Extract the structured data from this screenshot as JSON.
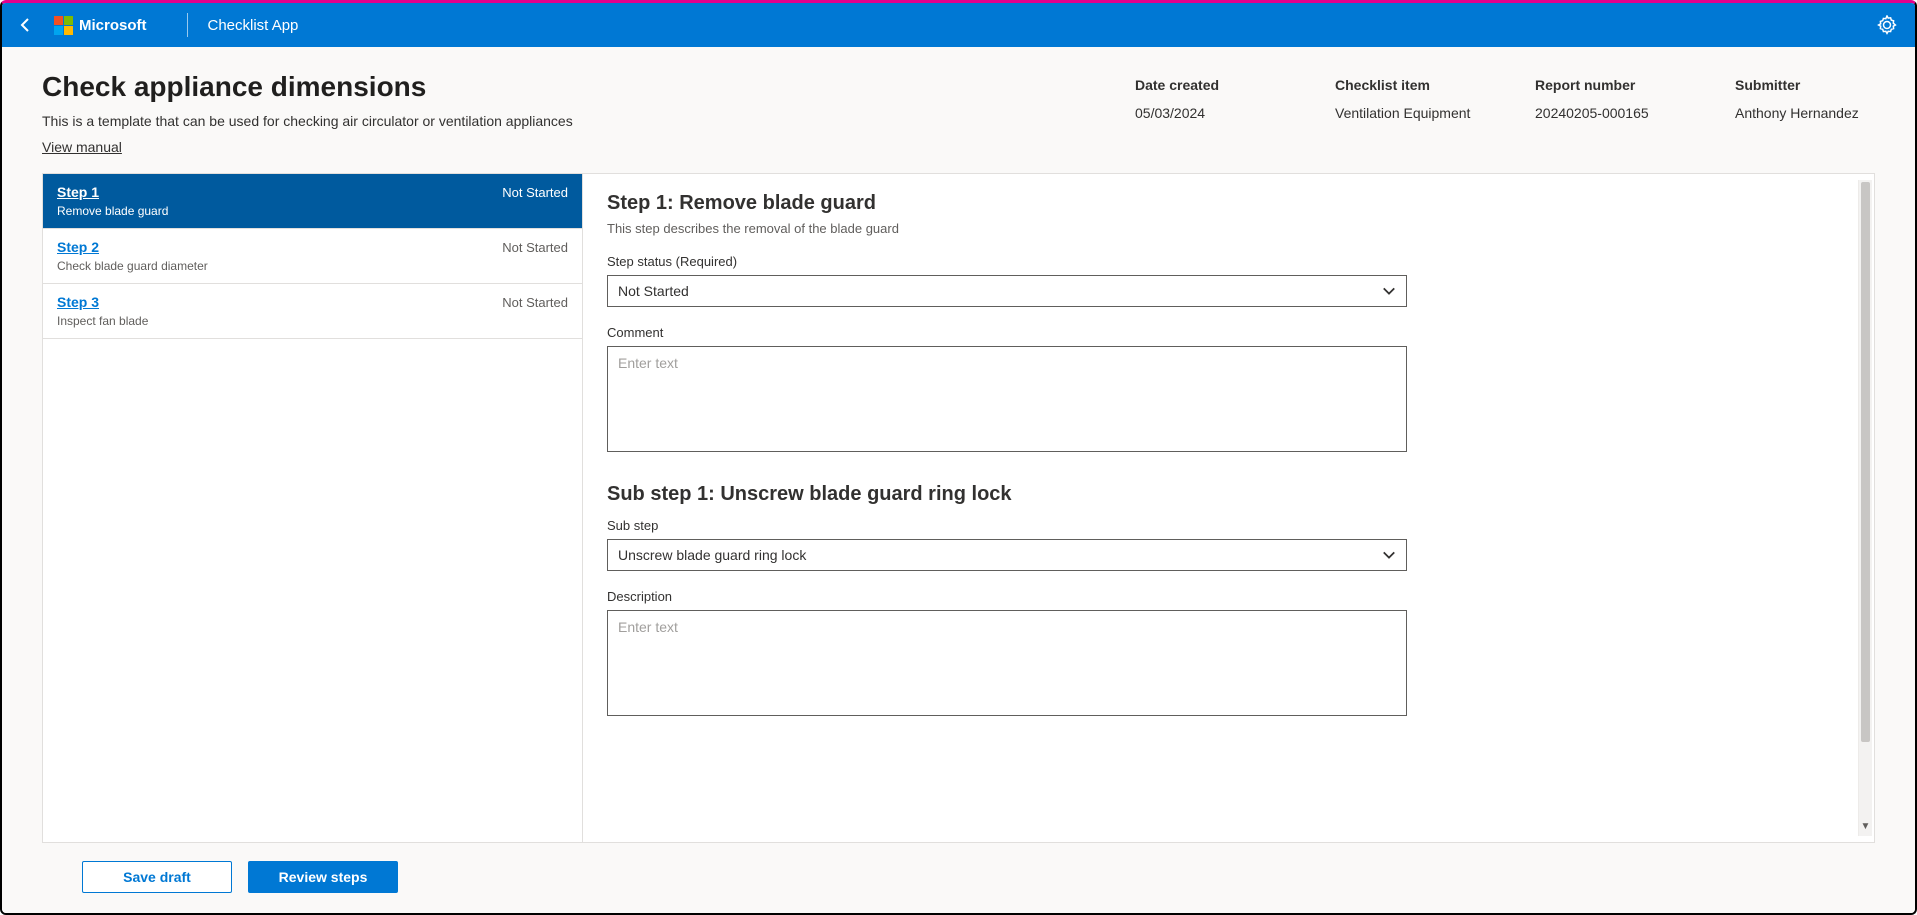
{
  "header": {
    "brand": "Microsoft",
    "app_title": "Checklist App"
  },
  "page": {
    "title": "Check appliance dimensions",
    "subtitle": "This is a template that can be used for checking air circulator or ventilation appliances",
    "view_manual": "View manual"
  },
  "meta": {
    "date_created_label": "Date created",
    "date_created_value": "05/03/2024",
    "checklist_item_label": "Checklist item",
    "checklist_item_value": "Ventilation Equipment",
    "report_number_label": "Report number",
    "report_number_value": "20240205-000165",
    "submitter_label": "Submitter",
    "submitter_value": "Anthony Hernandez"
  },
  "steps": [
    {
      "label": "Step 1",
      "desc": "Remove blade guard",
      "status": "Not Started",
      "active": true
    },
    {
      "label": "Step 2",
      "desc": "Check blade guard diameter",
      "status": "Not Started",
      "active": false
    },
    {
      "label": "Step 3",
      "desc": "Inspect fan blade",
      "status": "Not Started",
      "active": false
    }
  ],
  "detail": {
    "title": "Step 1: Remove blade guard",
    "desc": "This step describes the removal of the blade guard",
    "status_label": "Step status (Required)",
    "status_value": "Not Started",
    "comment_label": "Comment",
    "comment_placeholder": "Enter text",
    "substep_title": "Sub step 1: Unscrew blade guard ring lock",
    "substep_label": "Sub step",
    "substep_value": "Unscrew blade guard ring lock",
    "description_label": "Description",
    "description_placeholder": "Enter text"
  },
  "footer": {
    "save_draft": "Save draft",
    "review_steps": "Review steps"
  }
}
